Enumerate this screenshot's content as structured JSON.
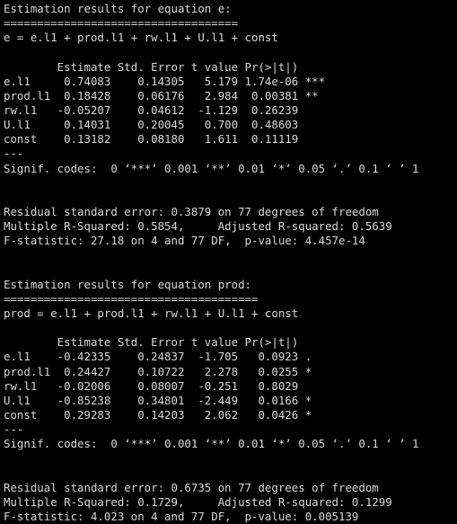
{
  "colors": {
    "background": "#000000",
    "text": "#d9d9d9"
  },
  "console": {
    "lines": [
      "Estimation results for equation e:",
      "===================================",
      "e = e.l1 + prod.l1 + rw.l1 + U.l1 + const",
      "",
      "        Estimate Std. Error t value Pr(>|t|)",
      "e.l1     0.74083    0.14305   5.179 1.74e-06 ***",
      "prod.l1  0.18428    0.06176   2.984  0.00381 **",
      "rw.l1   -0.05207    0.04612  -1.129  0.26239",
      "U.l1     0.14031    0.20045   0.700  0.48603",
      "const    0.13182    0.08180   1.611  0.11119",
      "---",
      "Signif. codes:  0 ‘***’ 0.001 ‘**’ 0.01 ‘*’ 0.05 ‘.’ 0.1 ‘ ’ 1",
      "",
      "",
      "Residual standard error: 0.3879 on 77 degrees of freedom",
      "Multiple R-Squared: 0.5854,     Adjusted R-squared: 0.5639",
      "F-statistic: 27.18 on 4 and 77 DF,  p-value: 4.457e-14",
      "",
      "",
      "Estimation results for equation prod:",
      "======================================",
      "prod = e.l1 + prod.l1 + rw.l1 + U.l1 + const",
      "",
      "        Estimate Std. Error t value Pr(>|t|)",
      "e.l1    -0.42335    0.24837  -1.705   0.0923 .",
      "prod.l1  0.24427    0.10722   2.278   0.0255 *",
      "rw.l1   -0.02006    0.08007  -0.251   0.8029",
      "U.l1    -0.85238    0.34801  -2.449   0.0166 *",
      "const    0.29283    0.14203   2.062   0.0426 *",
      "---",
      "Signif. codes:  0 ‘***’ 0.001 ‘**’ 0.01 ‘*’ 0.05 ‘.’ 0.1 ‘ ’ 1",
      "",
      "",
      "Residual standard error: 0.6735 on 77 degrees of freedom",
      "Multiple R-Squared: 0.1729,     Adjusted R-squared: 0.1299",
      "F-statistic: 4.023 on 4 and 77 DF,  p-value: 0.005139"
    ]
  }
}
